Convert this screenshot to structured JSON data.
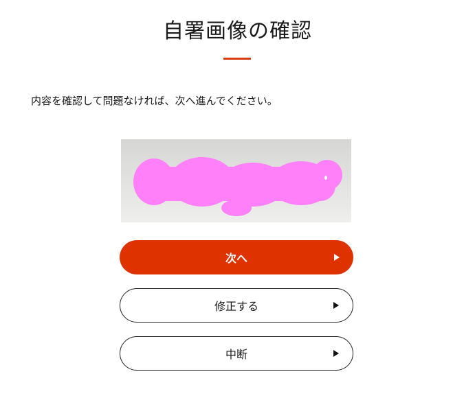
{
  "header": {
    "title": "自署画像の確認"
  },
  "main": {
    "instruction": "内容を確認して問題なければ、次へ進んでください。"
  },
  "signature_preview": {
    "redaction_color": "#ff80f8"
  },
  "buttons": {
    "next_label": "次へ",
    "edit_label": "修正する",
    "abort_label": "中断"
  },
  "colors": {
    "accent": "#de3300"
  }
}
